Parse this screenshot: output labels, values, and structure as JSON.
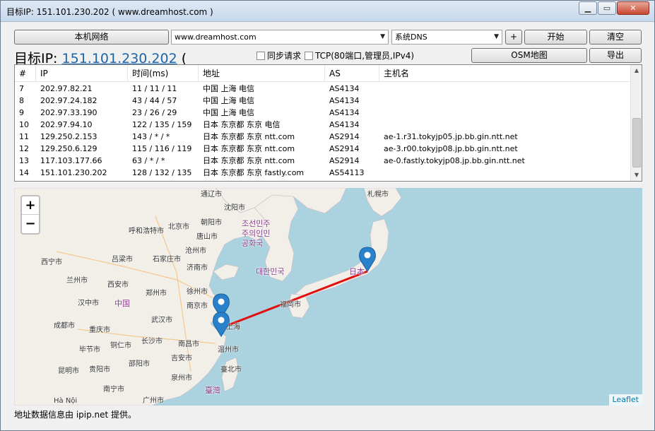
{
  "window": {
    "title": "目标IP: 151.101.230.202 ( www.dreamhost.com )"
  },
  "toolbar": {
    "local_network_label": "本机网络",
    "host_value": "www.dreamhost.com",
    "dns_value": "系统DNS",
    "add_label": "+",
    "start_label": "开始",
    "clear_label": "清空",
    "osm_label": "OSM地图",
    "export_label": "导出"
  },
  "target": {
    "prefix": "目标IP: ",
    "ip": "151.101.230.202",
    "suffix": " ("
  },
  "options": {
    "sync_label": "同步请求",
    "tcp_label": "TCP(80端口,管理员,IPv4)"
  },
  "table": {
    "columns": [
      "#",
      "IP",
      "时间(ms)",
      "地址",
      "AS",
      "主机名"
    ],
    "rows": [
      [
        "7",
        "202.97.82.21",
        "11 / 11 / 11",
        "中国 上海 电信",
        "AS4134",
        ""
      ],
      [
        "8",
        "202.97.24.182",
        "43 / 44 / 57",
        "中国 上海 电信",
        "AS4134",
        ""
      ],
      [
        "9",
        "202.97.33.190",
        "23 / 26 / 29",
        "中国 上海 电信",
        "AS4134",
        ""
      ],
      [
        "10",
        "202.97.94.10",
        "122 / 135 / 159",
        "日本 东京都 东京 电信",
        "AS4134",
        ""
      ],
      [
        "11",
        "129.250.2.153",
        "143 / * / *",
        "日本 东京都 东京 ntt.com",
        "AS2914",
        "ae-1.r31.tokyjp05.jp.bb.gin.ntt.net"
      ],
      [
        "12",
        "129.250.6.129",
        "115 / 116 / 119",
        "日本 东京都 东京 ntt.com",
        "AS2914",
        "ae-3.r00.tokyjp08.jp.bb.gin.ntt.net"
      ],
      [
        "13",
        "117.103.177.66",
        "63 / * / *",
        "日本 东京都 东京 ntt.com",
        "AS2914",
        "ae-0.fastly.tokyjp08.jp.bb.gin.ntt.net"
      ],
      [
        "14",
        "151.101.230.202",
        "128 / 132 / 135",
        "日本 东京都 东京 fastly.com",
        "AS54113",
        ""
      ]
    ]
  },
  "map": {
    "zoom_in": "+",
    "zoom_out": "−",
    "attribution": "Leaflet",
    "labels": {
      "tongliao": "通辽市",
      "sapporo": "札幌市",
      "shenyang": "沈阳市",
      "hohhot": "呼和浩特市",
      "beijing": "北京市",
      "chaoyang": "朝阳市",
      "tangshan": "唐山市",
      "dprk": "조선민주주의인민공화국",
      "cangzhou": "沧州市",
      "shijiazhuang": "石家庄市",
      "lvliang": "吕梁市",
      "jinan": "济南市",
      "xining": "西宁市",
      "lanzhou": "兰州市",
      "xian": "西安市",
      "zhengzhou": "郑州市",
      "xuzhou": "徐州市",
      "korea": "대한민국",
      "japan": "日本",
      "hanzhong": "汉中市",
      "china": "中国",
      "nanjing": "南京市",
      "fukuoka": "福岡市",
      "wuhan": "武汉市",
      "chengdu": "成都市",
      "chongqing": "重庆市",
      "shanghai": "上海",
      "bijie": "毕节市",
      "tongren": "铜仁市",
      "changsha": "长沙市",
      "nanchang": "南昌市",
      "wenzhou": "温州市",
      "shaoyang": "邵阳市",
      "jian": "吉安市",
      "kunming": "昆明市",
      "guiyang": "贵阳市",
      "taipei": "臺北市",
      "quanzhou": "泉州市",
      "taiwan": "臺灣",
      "nanning": "南宁市",
      "guangzhou": "广州市",
      "hanoi": "Hà Nội"
    }
  },
  "status": {
    "text": "地址数据信息由 ipip.net 提供。"
  },
  "colors": {
    "route": "#e01010",
    "marker": "#2a81cb",
    "sea": "#abd3df",
    "land": "#f2efe9",
    "link": "#1e64a8"
  }
}
